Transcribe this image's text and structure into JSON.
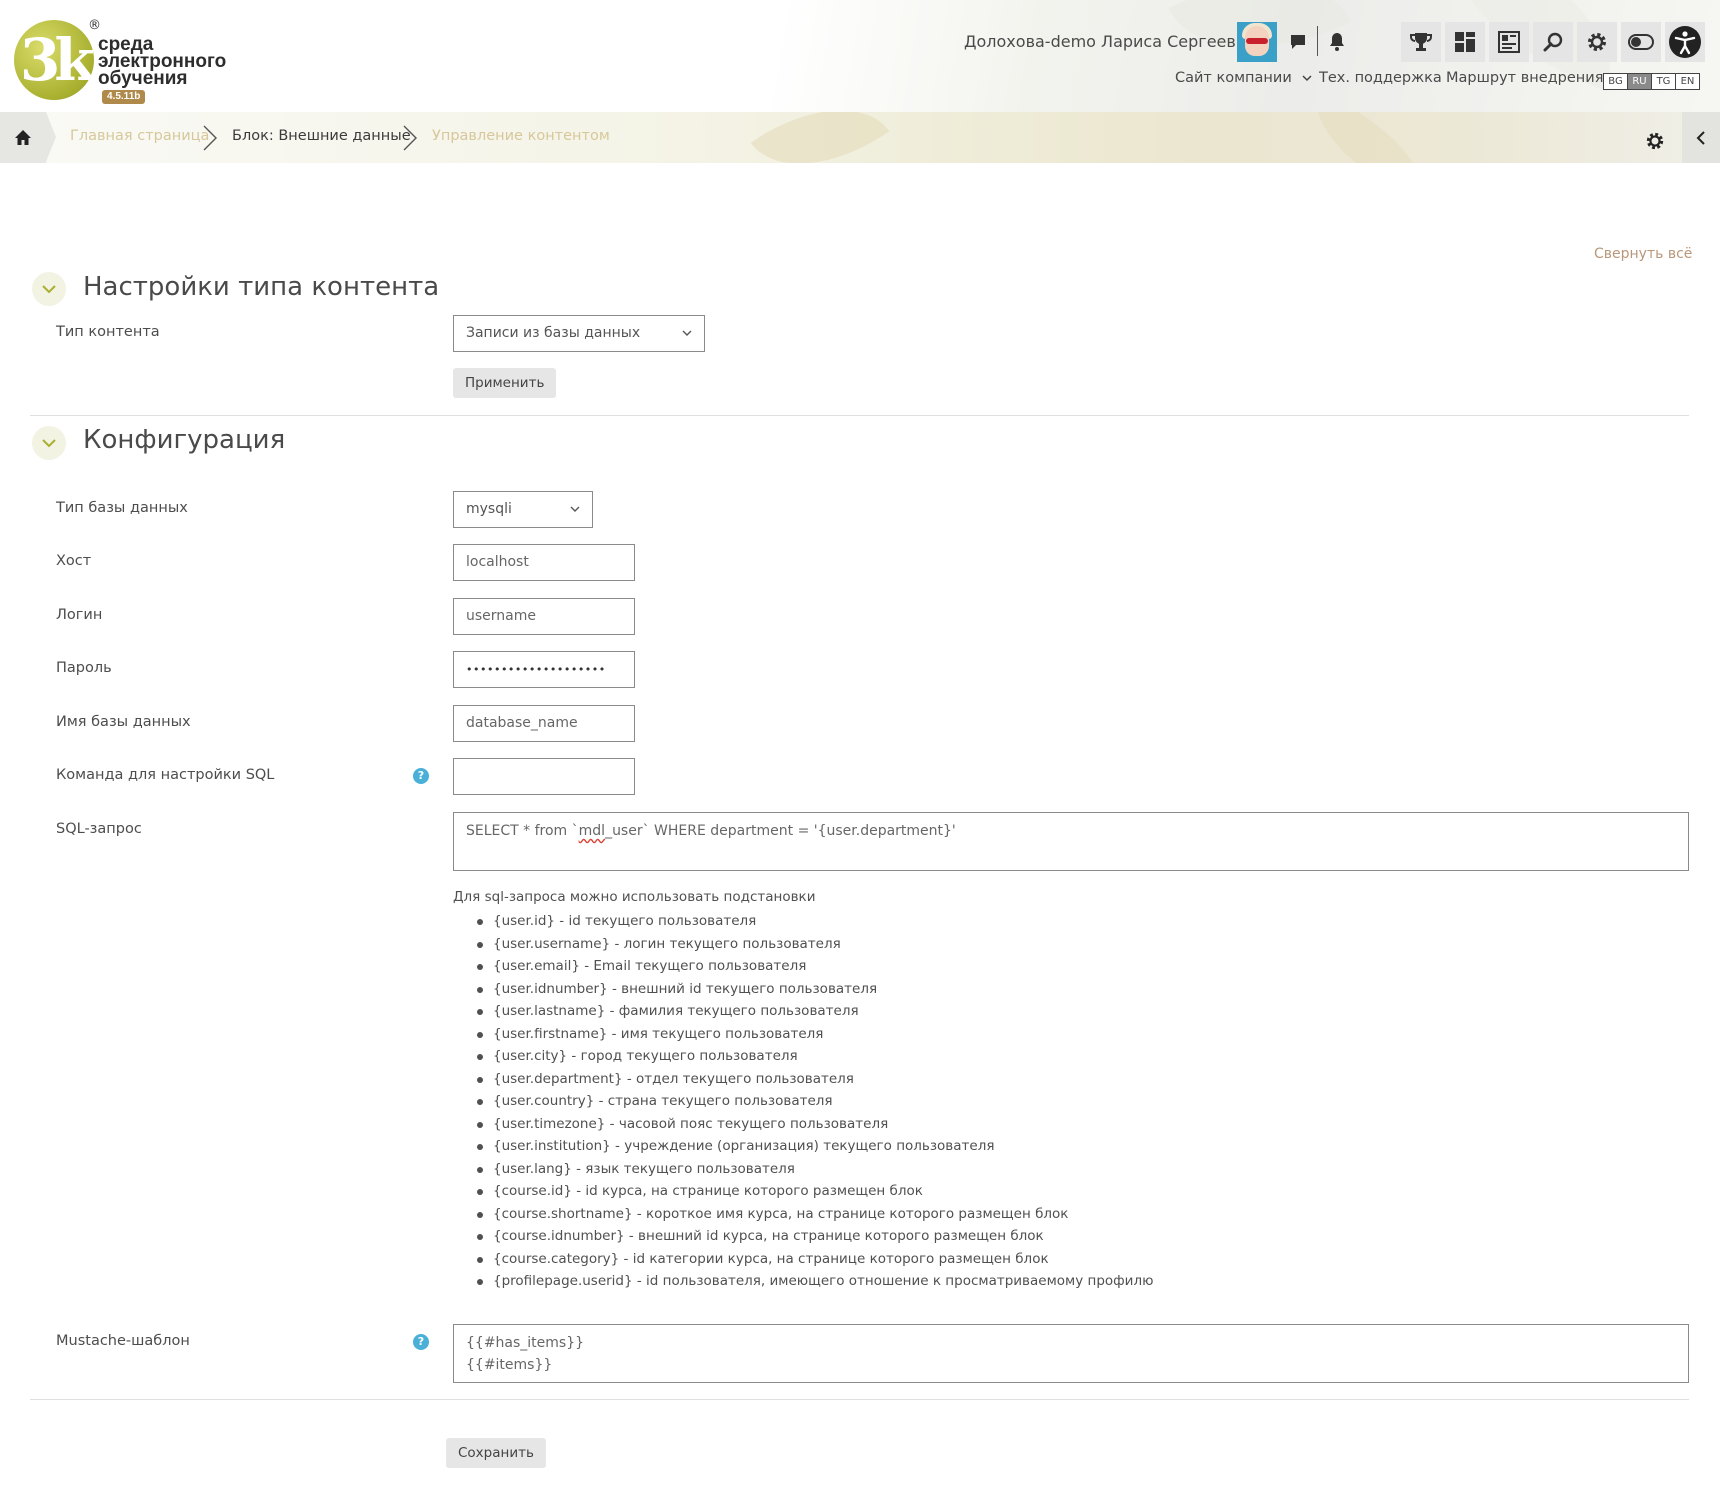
{
  "header": {
    "logo": {
      "mark": "3k",
      "line1": "среда",
      "line2": "электронного",
      "line3": "обучения",
      "version": "4.5.11b",
      "reg": "®"
    },
    "user_name": "Долохова-demo Лариса Сергеевна",
    "nav": {
      "company_site": "Сайт компании",
      "support": "Тех. поддержка",
      "route": "Маршрут внедрения"
    },
    "languages": [
      "BG",
      "RU",
      "TG",
      "EN"
    ],
    "active_language": "RU"
  },
  "breadcrumb": {
    "home": "Главная страница",
    "block": "Блок: Внешние данные",
    "current": "Управление контентом"
  },
  "collapse_all": "Свернуть всё",
  "section_content_type": {
    "title": "Настройки типа контента",
    "content_type_label": "Тип контента",
    "content_type_value": "Записи из базы данных",
    "apply_button": "Применить"
  },
  "section_config": {
    "title": "Конфигурация",
    "db_type_label": "Тип базы данных",
    "db_type_value": "mysqli",
    "host_label": "Хост",
    "host_value": "localhost",
    "login_label": "Логин",
    "login_value": "username",
    "password_label": "Пароль",
    "password_value": "••••••••••••••••••••",
    "db_name_label": "Имя базы данных",
    "db_name_value": "database_name",
    "sql_setup_label": "Команда для настройки SQL",
    "sql_setup_value": "",
    "sql_query_label": "SQL-запрос",
    "sql_query_pre": "SELECT * from `",
    "sql_query_spell": "mdl",
    "sql_query_post": "_user` WHERE department = '{user.department}'",
    "hint_title": "Для sql-запроса можно использовать подстановки",
    "hints": [
      "{user.id} - id текущего пользователя",
      "{user.username} - логин текущего пользователя",
      "{user.email} - Email текущего пользователя",
      "{user.idnumber} - внешний id текущего пользователя",
      "{user.lastname} - фамилия текущего пользователя",
      "{user.firstname} - имя текущего пользователя",
      "{user.city} - город текущего пользователя",
      "{user.department} - отдел текущего пользователя",
      "{user.country} - страна текущего пользователя",
      "{user.timezone} - часовой пояс текущего пользователя",
      "{user.institution} - учреждение (организация) текущего пользователя",
      "{user.lang} - язык текущего пользователя",
      "{course.id} - id курса, на странице которого размещен блок",
      "{course.shortname} - короткое имя курса, на странице которого размещен блок",
      "{course.idnumber} - внешний id курса, на странице которого размещен блок",
      "{course.category} - id категории курса, на странице которого размещен блок",
      "{profilepage.userid} - id пользователя, имеющего отношение к просматриваемому профилю"
    ],
    "mustache_label": "Mustache-шаблон",
    "mustache_line1": "{{#has_items}}",
    "mustache_line2": "{{#items}}"
  },
  "save_button": "Сохранить",
  "colors": {
    "accent": "#a9b02f",
    "link_muted": "#d7c79a",
    "collapse_link": "#b9977a",
    "help": "#4ab0d8"
  }
}
